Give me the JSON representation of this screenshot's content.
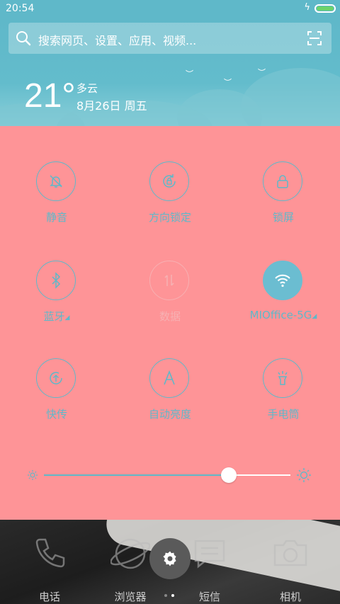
{
  "status_bar": {
    "time": "20:54",
    "charging": "ϟ"
  },
  "search": {
    "placeholder": "搜索网页、设置、应用、视频..."
  },
  "weather": {
    "temperature": "21°",
    "condition": "多云",
    "date": "8月26日 周五"
  },
  "toggles": [
    {
      "label": "静音",
      "icon": "bell-off-icon",
      "state": "off"
    },
    {
      "label": "方向锁定",
      "icon": "rotation-lock-icon",
      "state": "off"
    },
    {
      "label": "锁屏",
      "icon": "lock-icon",
      "state": "off"
    },
    {
      "label": "蓝牙",
      "icon": "bluetooth-icon",
      "state": "off",
      "expandable": true
    },
    {
      "label": "数据",
      "icon": "mobile-data-icon",
      "state": "disabled"
    },
    {
      "label": "MIOffice-5G",
      "icon": "wifi-icon",
      "state": "on",
      "expandable": true
    },
    {
      "label": "快传",
      "icon": "quick-share-icon",
      "state": "off"
    },
    {
      "label": "自动亮度",
      "icon": "auto-brightness-icon",
      "state": "off"
    },
    {
      "label": "手电筒",
      "icon": "flashlight-icon",
      "state": "off"
    }
  ],
  "brightness": {
    "level": 0.75
  },
  "dock": {
    "apps": [
      {
        "label": "电话",
        "icon": "phone-icon"
      },
      {
        "label": "浏览器",
        "icon": "browser-icon"
      },
      {
        "label": "短信",
        "icon": "message-icon"
      },
      {
        "label": "相机",
        "icon": "camera-icon"
      }
    ],
    "pages": 2,
    "current_page": 1
  },
  "colors": {
    "accent": "#5fb8c9",
    "panel_bg": "#fe9497",
    "battery": "#6cd36a"
  }
}
